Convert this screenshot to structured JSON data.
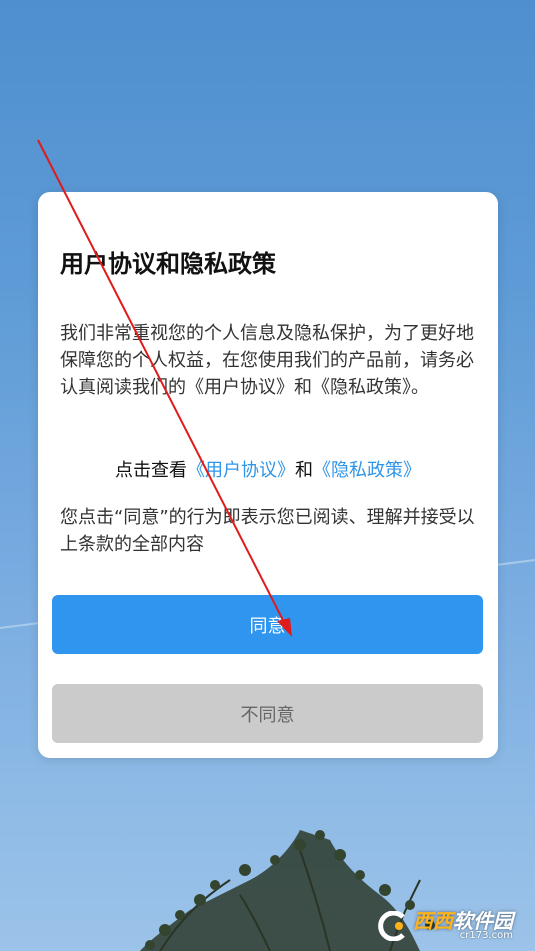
{
  "dialog": {
    "title": "用户协议和隐私政策",
    "body": "我们非常重视您的个人信息及隐私保护，为了更好地保障您的个人权益，在您使用我们的产品前，请务必认真阅读我们的《用户协议》和《隐私政策》。",
    "links_prefix": "点击查看",
    "user_agreement_link": "《用户协议》",
    "links_and": "和",
    "privacy_policy_link": "《隐私政策》",
    "note": "您点击“同意”的行为即表示您已阅读、理解并接受以上条款的全部内容",
    "agree_label": "同意",
    "disagree_label": "不同意"
  },
  "watermark": {
    "brand_part1": "西西",
    "brand_part2": "软件园",
    "url": "cr173.com"
  },
  "colors": {
    "accent": "#2f95ef",
    "link": "#2f95e8",
    "disabled_button": "#cbcbcb",
    "annotation_arrow": "#e01b1b"
  },
  "icons": {
    "watermark_logo": "cr173-logo-icon",
    "annotation": "red-arrow-annotation"
  }
}
